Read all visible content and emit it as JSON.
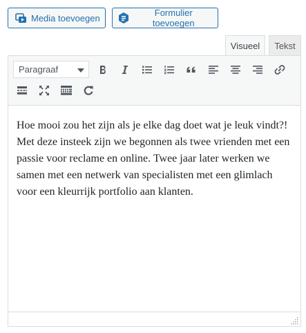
{
  "toolbar_top": {
    "media_label": "Media toevoegen",
    "form_label": "Formulier toevoegen"
  },
  "tabs": [
    {
      "label": "Visueel",
      "active": true
    },
    {
      "label": "Tekst",
      "active": false
    }
  ],
  "editor": {
    "format_value": "Paragraaf",
    "icons": [
      "bold-icon",
      "italic-icon",
      "bulleted-list-icon",
      "numbered-list-icon",
      "blockquote-icon",
      "align-left-icon",
      "align-center-icon",
      "align-right-icon",
      "link-icon",
      "read-more-icon",
      "fullscreen-icon",
      "toolbar-toggle-icon",
      "refresh-icon"
    ],
    "content": "Hoe mooi zou het zijn als je elke dag doet wat je leuk vindt?! Met deze insteek zijn we begonnen als twee vrienden met een passie voor reclame en online. Twee jaar later werken we samen met een netwerk van specialisten met een glimlach voor een kleurrijk portfolio aan klanten."
  },
  "colors": {
    "accent": "#2271b1",
    "border": "#dcdcde",
    "toolbar_bg": "#f6f7f7",
    "icon": "#50575e",
    "text": "#1d2327"
  }
}
